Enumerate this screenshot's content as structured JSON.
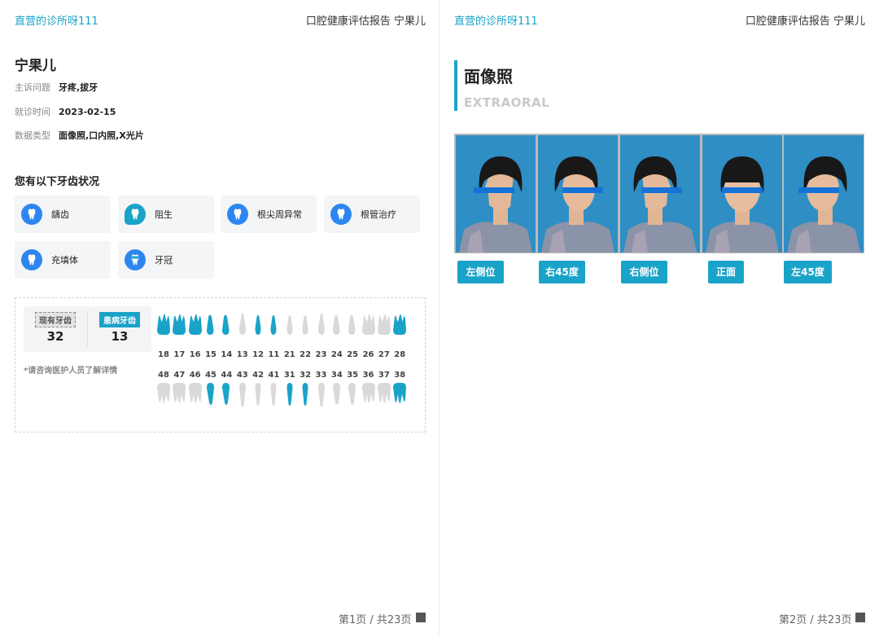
{
  "page1": {
    "clinic": "直营的诊所呀111",
    "report_title": "口腔健康评估报告 宁果儿",
    "patient_name": "宁果儿",
    "info": [
      {
        "label": "主诉问题",
        "value": "牙疼,拔牙"
      },
      {
        "label": "就诊时间",
        "value": "2023-02-15"
      },
      {
        "label": "数据类型",
        "value": "面像照,口内照,X光片"
      }
    ],
    "conditions_heading": "您有以下牙齿状况",
    "conditions": [
      {
        "label": "龋齿",
        "icon": "tooth-icon"
      },
      {
        "label": "阻生",
        "icon": "impacted-tooth-icon"
      },
      {
        "label": "根尖周异常",
        "icon": "tooth-icon"
      },
      {
        "label": "根管治疗",
        "icon": "tooth-icon"
      },
      {
        "label": "充填体",
        "icon": "tooth-icon"
      },
      {
        "label": "牙冠",
        "icon": "crown-tooth-icon"
      }
    ],
    "existing_teeth_label": "现有牙齿",
    "existing_teeth_count": "32",
    "diseased_teeth_label": "患病牙齿",
    "diseased_teeth_count": "13",
    "consult_note": "*请咨询医护人员了解详情",
    "upper_teeth": [
      {
        "num": "18",
        "diseased": true
      },
      {
        "num": "17",
        "diseased": true
      },
      {
        "num": "16",
        "diseased": true
      },
      {
        "num": "15",
        "diseased": true
      },
      {
        "num": "14",
        "diseased": true
      },
      {
        "num": "13",
        "diseased": false
      },
      {
        "num": "12",
        "diseased": true
      },
      {
        "num": "11",
        "diseased": true
      },
      {
        "num": "21",
        "diseased": false
      },
      {
        "num": "22",
        "diseased": false
      },
      {
        "num": "23",
        "diseased": false
      },
      {
        "num": "24",
        "diseased": false
      },
      {
        "num": "25",
        "diseased": false
      },
      {
        "num": "26",
        "diseased": false
      },
      {
        "num": "27",
        "diseased": false
      },
      {
        "num": "28",
        "diseased": true
      }
    ],
    "lower_teeth": [
      {
        "num": "48",
        "diseased": false
      },
      {
        "num": "47",
        "diseased": false
      },
      {
        "num": "46",
        "diseased": false
      },
      {
        "num": "45",
        "diseased": true
      },
      {
        "num": "44",
        "diseased": true
      },
      {
        "num": "43",
        "diseased": false
      },
      {
        "num": "42",
        "diseased": false
      },
      {
        "num": "41",
        "diseased": false
      },
      {
        "num": "31",
        "diseased": true
      },
      {
        "num": "32",
        "diseased": true
      },
      {
        "num": "33",
        "diseased": false
      },
      {
        "num": "34",
        "diseased": false
      },
      {
        "num": "35",
        "diseased": false
      },
      {
        "num": "36",
        "diseased": false
      },
      {
        "num": "37",
        "diseased": false
      },
      {
        "num": "38",
        "diseased": true
      }
    ],
    "page_number": "第1页 / 共23页"
  },
  "page2": {
    "clinic": "直营的诊所呀111",
    "report_title": "口腔健康评估报告 宁果儿",
    "section_title": "面像照",
    "section_subtitle": "EXTRAORAL",
    "photos": [
      {
        "label": "左侧位",
        "view": "left-profile"
      },
      {
        "label": "右45度",
        "view": "right-45"
      },
      {
        "label": "右侧位",
        "view": "right-profile"
      },
      {
        "label": "正面",
        "view": "front"
      },
      {
        "label": "左45度",
        "view": "left-45"
      }
    ],
    "page_number": "第2页 / 共23页"
  },
  "colors": {
    "accent": "#1aa3c8",
    "icon_blue": "#2d86f0",
    "healthy_tooth": "#d9d9d9",
    "diseased_tooth": "#1aa3c8",
    "photo_background": "#2f8ec4"
  }
}
